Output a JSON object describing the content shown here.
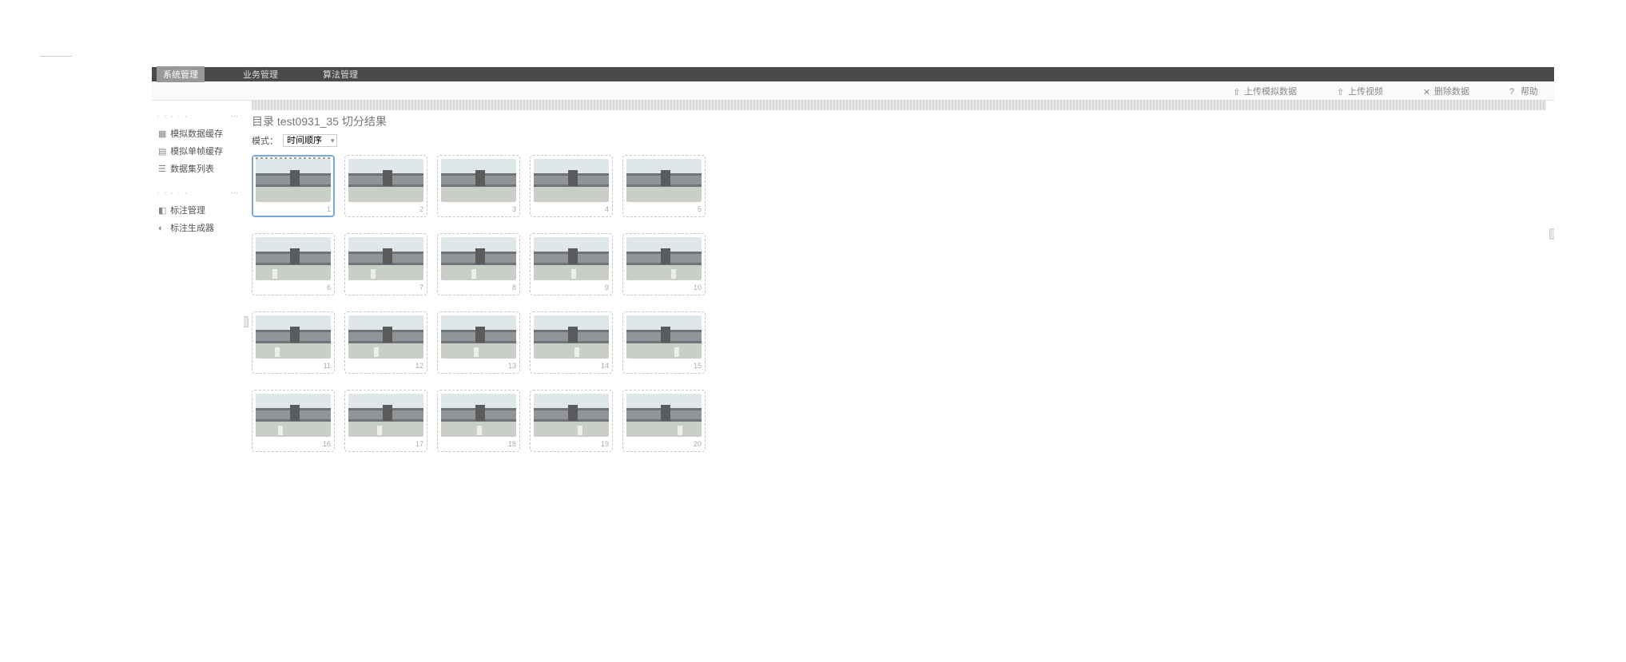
{
  "topbar": {
    "tabs": [
      {
        "label": "系统管理",
        "active": true
      },
      {
        "label": "业务管理",
        "active": false
      },
      {
        "label": "算法管理",
        "active": false
      }
    ]
  },
  "subbar": {
    "actions": [
      {
        "label": "上传模拟数据",
        "icon": "upload-icon"
      },
      {
        "label": "上传视频",
        "icon": "upload-icon"
      },
      {
        "label": "删除数据",
        "icon": "trash-icon"
      },
      {
        "label": "帮助",
        "icon": "help-icon"
      }
    ]
  },
  "sidebar": {
    "group1": {
      "label": "· · · · ·",
      "items": [
        {
          "label": "模拟数据缓存",
          "icon": "grid-icon"
        },
        {
          "label": "模拟单帧缓存",
          "icon": "film-icon"
        },
        {
          "label": "数据集列表",
          "icon": "list-icon"
        }
      ]
    },
    "group2": {
      "label": "· · · · ·",
      "items": [
        {
          "label": "标注管理",
          "icon": "tag-icon"
        },
        {
          "label": "标注生成器",
          "icon": "gear-icon"
        }
      ]
    }
  },
  "content": {
    "title": "目录 test0931_35 切分结果",
    "filter_label": "模式：",
    "filter_value": "时间顺序",
    "thumbs": [
      [
        {
          "cap": "1",
          "sel": true,
          "fx": 0
        },
        {
          "cap": "2",
          "fx": 0
        },
        {
          "cap": "3",
          "fx": 0
        },
        {
          "cap": "4",
          "fx": 0
        },
        {
          "cap": "5",
          "fx": 0
        }
      ],
      [
        {
          "cap": "6",
          "fx": 22
        },
        {
          "cap": "7",
          "fx": 30
        },
        {
          "cap": "8",
          "fx": 40
        },
        {
          "cap": "9",
          "fx": 50
        },
        {
          "cap": "10",
          "fx": 60
        }
      ],
      [
        {
          "cap": "11",
          "fx": 26
        },
        {
          "cap": "12",
          "fx": 34
        },
        {
          "cap": "13",
          "fx": 44
        },
        {
          "cap": "14",
          "fx": 54
        },
        {
          "cap": "15",
          "fx": 64
        }
      ],
      [
        {
          "cap": "16",
          "fx": 30
        },
        {
          "cap": "17",
          "fx": 38
        },
        {
          "cap": "18",
          "fx": 48
        },
        {
          "cap": "19",
          "fx": 58
        },
        {
          "cap": "20",
          "fx": 68
        }
      ]
    ]
  }
}
